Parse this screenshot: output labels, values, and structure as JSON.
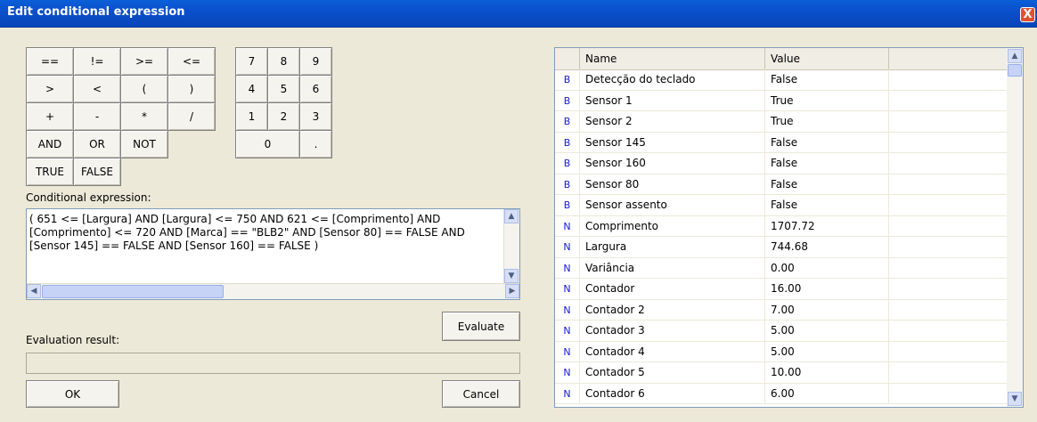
{
  "window": {
    "title": "Edit conditional expression",
    "close_label": "X"
  },
  "operators": [
    [
      "==",
      "!=",
      ">=",
      "<="
    ],
    [
      ">",
      "<",
      "(",
      ")"
    ],
    [
      "+",
      "-",
      "*",
      "/"
    ],
    [
      "AND",
      "OR",
      "NOT"
    ],
    [
      "TRUE",
      "FALSE"
    ]
  ],
  "keypad": [
    [
      "7",
      "8",
      "9"
    ],
    [
      "4",
      "5",
      "6"
    ],
    [
      "1",
      "2",
      "3"
    ],
    [
      "0",
      "."
    ]
  ],
  "expression": {
    "label": "Conditional expression:",
    "value": "( 651 <= [Largura] AND [Largura] <= 750 AND 621 <= [Comprimento] AND\n[Comprimento] <= 720 AND [Marca] == \"BLB2\" AND [Sensor 80] == FALSE AND\n[Sensor 145] == FALSE AND [Sensor 160] == FALSE )"
  },
  "evaluate_label": "Evaluate",
  "result": {
    "label": "Evaluation result:",
    "value": ""
  },
  "ok_label": "OK",
  "cancel_label": "Cancel",
  "variables": {
    "headers": {
      "name": "Name",
      "value": "Value"
    },
    "rows": [
      {
        "type": "B",
        "name": "Detecção do teclado",
        "value": "False"
      },
      {
        "type": "B",
        "name": "Sensor 1",
        "value": "True"
      },
      {
        "type": "B",
        "name": "Sensor 2",
        "value": "True"
      },
      {
        "type": "B",
        "name": "Sensor 145",
        "value": "False"
      },
      {
        "type": "B",
        "name": "Sensor 160",
        "value": "False"
      },
      {
        "type": "B",
        "name": "Sensor 80",
        "value": "False"
      },
      {
        "type": "B",
        "name": "Sensor assento",
        "value": "False"
      },
      {
        "type": "N",
        "name": "Comprimento",
        "value": "1707.72"
      },
      {
        "type": "N",
        "name": "Largura",
        "value": "744.68"
      },
      {
        "type": "N",
        "name": "Variância",
        "value": "0.00"
      },
      {
        "type": "N",
        "name": "Contador",
        "value": "16.00"
      },
      {
        "type": "N",
        "name": "Contador 2",
        "value": "7.00"
      },
      {
        "type": "N",
        "name": "Contador 3",
        "value": "5.00"
      },
      {
        "type": "N",
        "name": "Contador 4",
        "value": "5.00"
      },
      {
        "type": "N",
        "name": "Contador 5",
        "value": "10.00"
      },
      {
        "type": "N",
        "name": "Contador 6",
        "value": "6.00"
      }
    ]
  }
}
